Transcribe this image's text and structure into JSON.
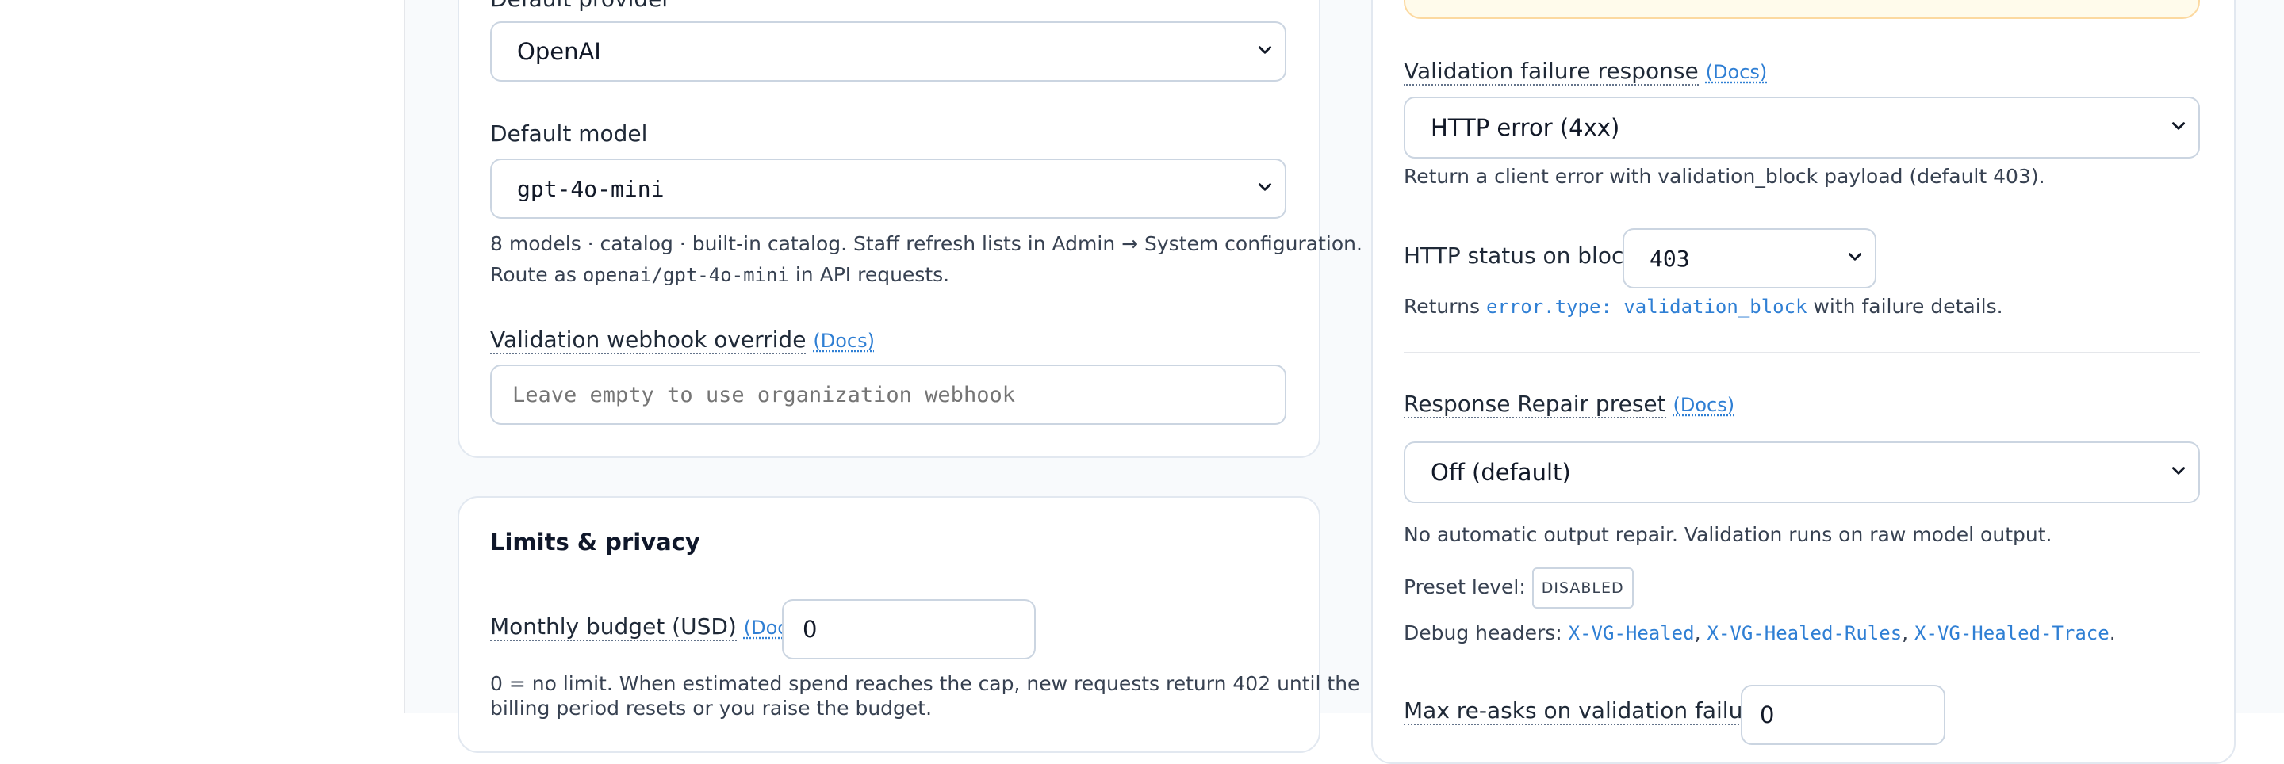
{
  "left_top": {
    "default_provider_label": "Default provider",
    "default_provider_value": "OpenAI",
    "default_model_label": "Default model",
    "default_model_value": "gpt-4o-mini",
    "model_help_line1": "8 models · catalog · built-in catalog. Staff refresh lists in Admin → System configuration.",
    "model_help_route_prefix": "Route as ",
    "model_help_route_code": "openai/gpt-4o-mini",
    "model_help_route_suffix": " in API requests.",
    "webhook_label": "Validation webhook override",
    "webhook_docs": "(Docs)",
    "webhook_value": "",
    "webhook_placeholder": "Leave empty to use organization webhook"
  },
  "limits": {
    "title": "Limits & privacy",
    "budget_label": "Monthly budget (USD)",
    "budget_docs": "(Docs)",
    "budget_value": "0",
    "budget_help_line1": "0 = no limit. When estimated spend reaches the cap, new requests return 402 until the",
    "budget_help_line2": "billing period resets or you raise the budget."
  },
  "right": {
    "failure_label": "Validation failure response",
    "failure_docs": "(Docs)",
    "failure_value": "HTTP error (4xx)",
    "failure_help": "Return a client error with validation_block payload (default 403).",
    "status_label": "HTTP status on block",
    "status_value": "403",
    "status_help_prefix": "Returns ",
    "status_help_code": "error.type: validation_block",
    "status_help_suffix": " with failure details.",
    "repair_label": "Response Repair preset",
    "repair_docs": "(Docs)",
    "repair_value": "Off (default)",
    "repair_help": "No automatic output repair. Validation runs on raw model output.",
    "preset_level_label": "Preset level:",
    "preset_level_badge": "DISABLED",
    "debug_label": "Debug headers:",
    "debug_h1": "X-VG-Healed",
    "debug_sep1": ", ",
    "debug_h2": "X-VG-Healed-Rules",
    "debug_sep2": ", ",
    "debug_h3": "X-VG-Healed-Trace",
    "debug_end": ".",
    "reasks_label": "Max re-asks on validation failure",
    "reasks_value": "0"
  },
  "colors": {
    "accent": "#2f7fd4",
    "warning_bg": "#fffbeb",
    "warning_border": "#fcd9a0",
    "card_border": "#e2e8f0",
    "page_bg": "#f8fafc"
  },
  "icons": {
    "select_chevron": "chevron-down-icon"
  }
}
